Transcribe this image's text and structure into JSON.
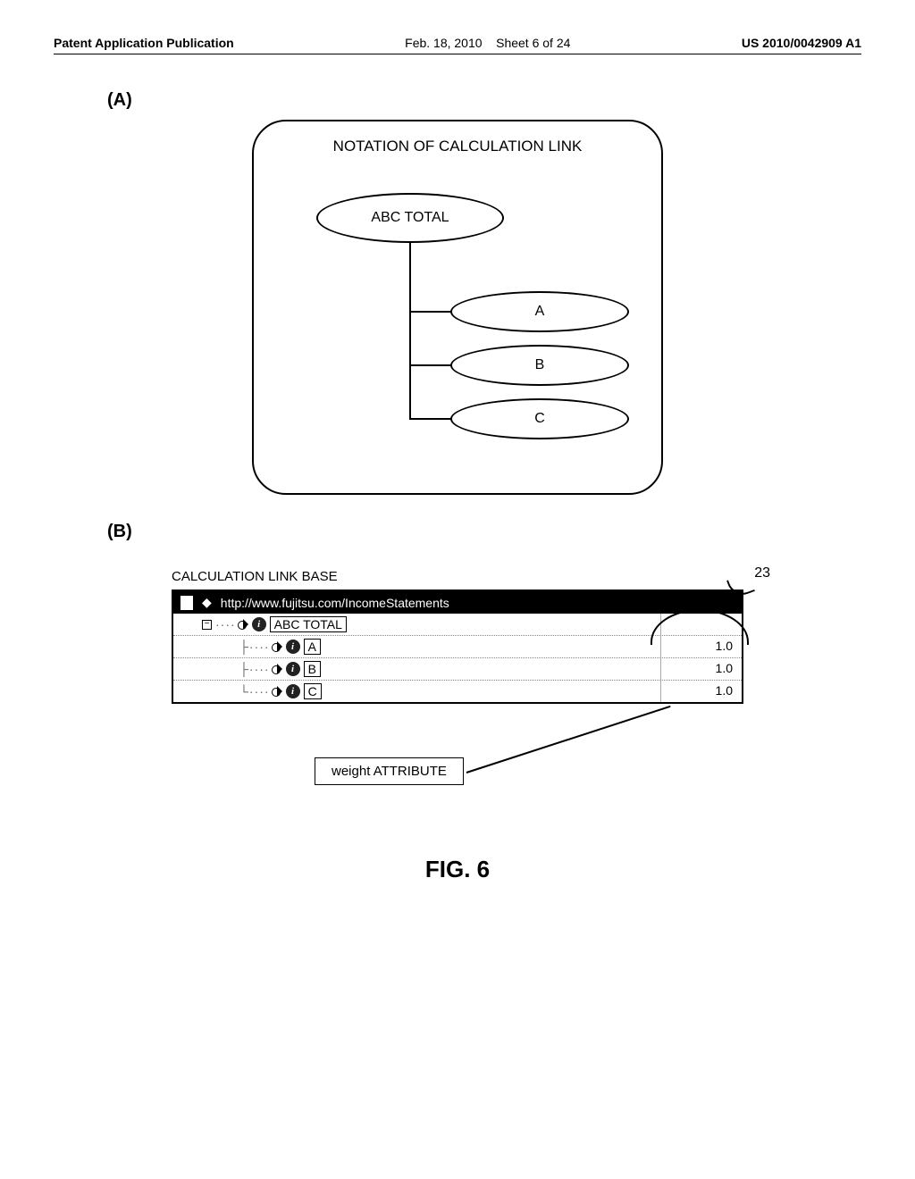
{
  "header": {
    "left": "Patent Application Publication",
    "date": "Feb. 18, 2010",
    "sheet": "Sheet 6 of 24",
    "right": "US 2010/0042909 A1"
  },
  "section": {
    "a_label": "(A)",
    "b_label": "(B)"
  },
  "panel_a": {
    "title": "NOTATION OF CALCULATION LINK",
    "total": "ABC TOTAL",
    "child_a": "A",
    "child_b": "B",
    "child_c": "C"
  },
  "panel_b": {
    "title": "CALCULATION LINK BASE",
    "ref": "23",
    "url": "http://www.fujitsu.com/IncomeStatements",
    "rows": [
      {
        "label": "ABC TOTAL",
        "value": ""
      },
      {
        "label": "A",
        "value": "1.0"
      },
      {
        "label": "B",
        "value": "1.0"
      },
      {
        "label": "C",
        "value": "1.0"
      }
    ],
    "weight_label": "weight ATTRIBUTE",
    "expand_minus": "−"
  },
  "figure_caption": "FIG. 6"
}
